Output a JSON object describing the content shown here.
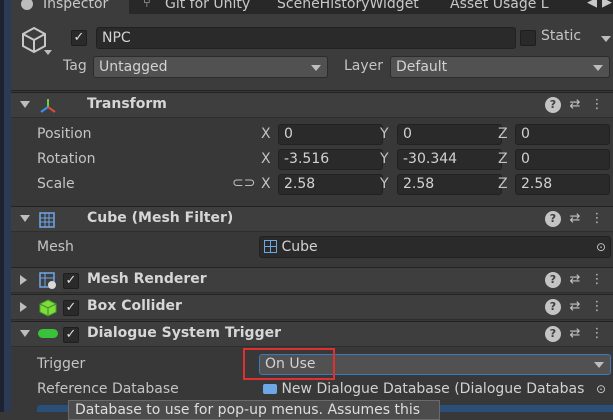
{
  "tabs": [
    {
      "label": "Inspector",
      "icon": "info-icon"
    },
    {
      "label": "Git for Unity",
      "icon": "git-icon"
    },
    {
      "label": "SceneHistoryWidget"
    },
    {
      "label": "Asset Usage L"
    }
  ],
  "header": {
    "active": true,
    "name": "NPC",
    "static_label": "Static",
    "tag_label": "Tag",
    "tag_value": "Untagged",
    "layer_label": "Layer",
    "layer_value": "Default"
  },
  "transform": {
    "title": "Transform",
    "rows": [
      {
        "label": "Position",
        "x": "0",
        "y": "0",
        "z": "0"
      },
      {
        "label": "Rotation",
        "x": "-3.516",
        "y": "-30.344",
        "z": "0"
      },
      {
        "label": "Scale",
        "x": "2.58",
        "y": "2.58",
        "z": "2.58"
      }
    ],
    "axis": {
      "x": "X",
      "y": "Y",
      "z": "Z"
    }
  },
  "mesh_filter": {
    "title": "Cube (Mesh Filter)",
    "mesh_label": "Mesh",
    "mesh_value": "Cube"
  },
  "mesh_renderer": {
    "title": "Mesh Renderer",
    "enabled": true
  },
  "box_collider": {
    "title": "Box Collider",
    "enabled": true
  },
  "dialogue_trigger": {
    "title": "Dialogue System Trigger",
    "enabled": true,
    "trigger_label": "Trigger",
    "trigger_value": "On Use",
    "ref_db_label": "Reference Database",
    "ref_db_value": "New Dialogue Database (Dialogue Databas"
  },
  "tooltip": "Database to use for pop-up menus. Assumes this",
  "colors": {
    "accent": "#3a79bb",
    "highlight": "#e0302f",
    "trigger_green": "#39c23a"
  }
}
